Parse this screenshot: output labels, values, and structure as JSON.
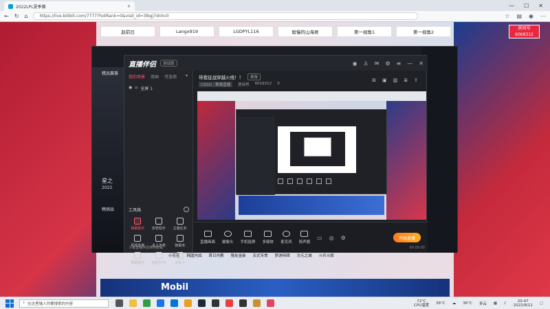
{
  "browser": {
    "tab_title": "2022LPL夏季赛",
    "url": "https://live.bilibili.com/7777?hotRank=0&visit_id=3lbgj7dnhc0"
  },
  "page": {
    "top_buttons": [
      "赵前日",
      "Langx919",
      "LGDPYL116",
      "聪慢的山海君",
      "第一视角1",
      "第一视角2"
    ],
    "room_badge_title": "房间号",
    "room_badge_number": "6069312",
    "nav_links": [
      "小花花",
      "韩国内战",
      "首日内赛",
      "慢友金装",
      "买式专季",
      "梦游特碑",
      "次元之城",
      "斗兵斗旗"
    ],
    "ad_text": "Mobil"
  },
  "live_room": {
    "left_label_1": "精品赛事",
    "left_label_2": "星之",
    "left_label_3": "2022",
    "left_label_4": "畅销品"
  },
  "app": {
    "logo": "直播伴侣",
    "version": "测试版",
    "side_tabs": [
      "我的场景",
      "双画",
      "可选项"
    ],
    "scene_item": "全屏 1",
    "tools_header": "工具箱",
    "tools": [
      {
        "label": "弹幕助手",
        "hot": true
      },
      {
        "label": "房管助手",
        "hot": false
      },
      {
        "label": "主播任务",
        "hot": false
      },
      {
        "label": "视频连麦",
        "hot": false
      },
      {
        "label": "多人连麦",
        "hot": false
      },
      {
        "label": "弹幕库",
        "hot": false
      },
      {
        "label": "数据助手",
        "hot": false
      },
      {
        "label": "全民乐PK",
        "hot": false
      },
      {
        "label": "大乱斗",
        "hot": false
      }
    ],
    "side_footer": "斗鱼直播伴侣使用教程",
    "stream_title": "带我征战穿越火线！！",
    "edit_label": "修改",
    "category": "CSGO · 赛事直播",
    "room_label": "房间号",
    "room_id": "6019312",
    "viewers": "0",
    "controls": [
      "直播画面",
      "摄像头",
      "手机投屏",
      "多媒体",
      "麦克风",
      "扬声器"
    ],
    "start_label": "开始直播",
    "timer": "00:00:00"
  },
  "taskbar": {
    "search_placeholder": "在这里输入你要搜索的内容",
    "temp_left": "72°C",
    "temp_left_label": "CPU温度",
    "temp_mid": "36°C",
    "temp_right": "36°C",
    "weather": "多云",
    "time": "20:47",
    "date": "2022/8/12"
  }
}
